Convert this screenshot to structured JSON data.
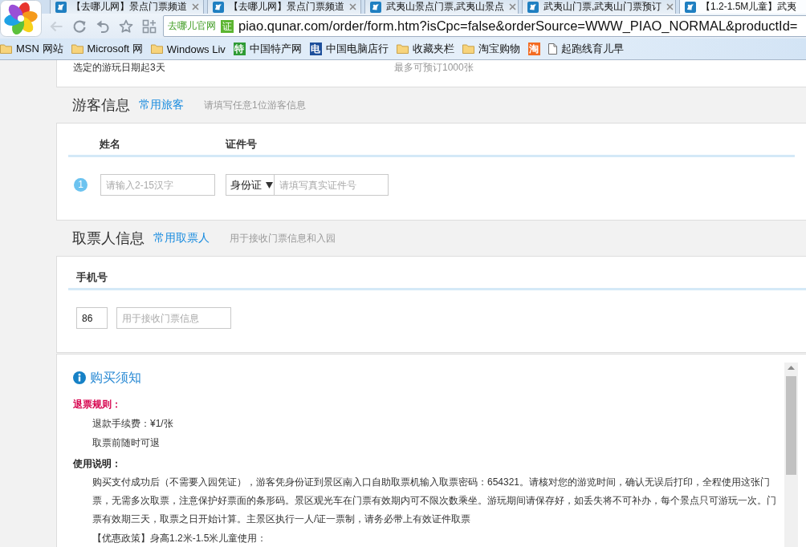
{
  "browser": {
    "tabs": [
      {
        "title": "【去哪儿网】景点门票频道",
        "selected": false
      },
      {
        "title": "【去哪儿网】景点门票频道",
        "selected": false
      },
      {
        "title": "武夷山景点门票,武夷山景点",
        "selected": false
      },
      {
        "title": "武夷山门票,武夷山门票预订",
        "selected": false
      },
      {
        "title": "【1.2-1.5M儿童】武夷",
        "selected": true
      }
    ],
    "address_bar": {
      "site_name": "去哪儿官网",
      "badge": "证",
      "url": "piao.qunar.com/order/form.htm?isCpc=false&orderSource=WWW_PIAO_NORMAL&productId="
    },
    "bookmarks": [
      {
        "kind": "folder",
        "label": "MSN 网站"
      },
      {
        "kind": "folder",
        "label": "Microsoft 网"
      },
      {
        "kind": "folder",
        "label": "Windows Liv"
      },
      {
        "kind": "site",
        "logo": "特",
        "color": "#2f9b35",
        "label": "中国特产网"
      },
      {
        "kind": "site",
        "logo": "电",
        "color": "#1d4f9b",
        "label": "中国电脑店行"
      },
      {
        "kind": "folder",
        "label": "收藏夹栏"
      },
      {
        "kind": "folder",
        "label": "淘宝购物"
      },
      {
        "kind": "site",
        "logo": "淘",
        "color": "#f36b21"
      },
      {
        "kind": "page",
        "label": "起跑线育儿早"
      }
    ]
  },
  "booking_summary": {
    "validity": "选定的游玩日期起3天",
    "max_quantity": "最多可预订1000张"
  },
  "visitor_info": {
    "title": "游客信息",
    "link": "常用旅客",
    "hint": "请填写任意1位游客信息",
    "columns": [
      "姓名",
      "证件号"
    ],
    "visitors": [
      {
        "number": "1",
        "name": {
          "placeholder": "请输入2-15汉字"
        },
        "id_type": "身份证",
        "id_number": {
          "placeholder": "请填写真实证件号"
        }
      }
    ]
  },
  "ticket_collector": {
    "title": "取票人信息",
    "link": "常用取票人",
    "hint": "用于接收门票信息和入园",
    "columns": [
      "手机号"
    ],
    "country_code": {
      "value": "86"
    },
    "phone": {
      "placeholder": "用于接收门票信息"
    }
  },
  "purchase_notes": {
    "title": "购买须知",
    "groups": [
      {
        "kind": "refund",
        "heading": "退票规则：",
        "lines": [
          "退款手续费：¥1/张",
          "取票前随时可退"
        ]
      },
      {
        "kind": "usage",
        "heading": "使用说明：",
        "lines": [
          "购买支付成功后（不需要入园凭证），游客凭身份证到景区南入口自助取票机输入取票密码：654321。请核对您的游览时间，确认无误后打印，全程使用这张门票，无需多次取票，注意保护好票面的条形码。景区观光车在门票有效期内可不限次数乘坐。游玩期间请保存好，如丢失将不可补办，每个景点只可游玩一次。门票有效期三天，取票之日开始计算。主景区执行一人/证一票制，请务必带上有效证件取票",
          "【优惠政策】身高1.2米-1.5米儿童使用："
        ]
      }
    ]
  }
}
